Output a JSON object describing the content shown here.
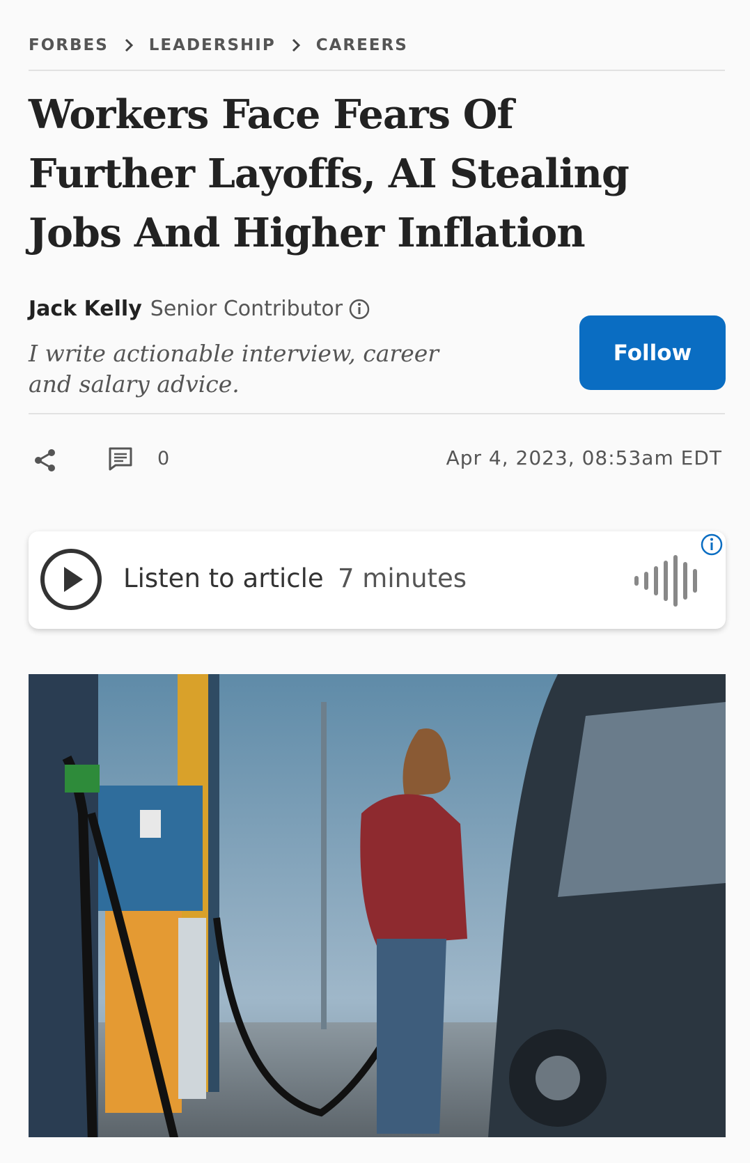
{
  "breadcrumb": {
    "items": [
      "FORBES",
      "LEADERSHIP",
      "CAREERS"
    ]
  },
  "article": {
    "headline": "Workers Face Fears Of Further Layoffs, AI Stealing Jobs And Higher Inflation",
    "author": "Jack Kelly",
    "role": "Senior Contributor",
    "bio": "I write actionable interview, career and salary advice.",
    "follow_label": "Follow",
    "comment_count": "0",
    "date": "Apr 4, 2023, 08:53am EDT"
  },
  "audio": {
    "label": "Listen to article",
    "duration": "7 minutes"
  },
  "colors": {
    "accent": "#0a6dc2",
    "text": "#222222",
    "muted": "#555555"
  },
  "icons": [
    "chevron-right-icon",
    "info-icon",
    "share-icon",
    "comment-icon",
    "play-icon",
    "soundwave-icon"
  ]
}
